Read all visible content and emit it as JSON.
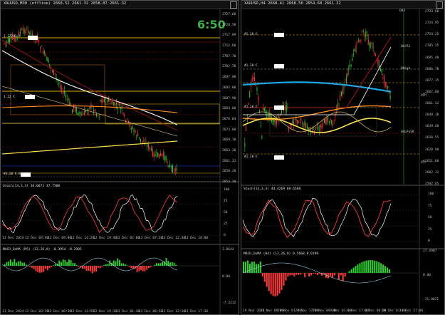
{
  "left": {
    "title": "XAUUSD,M30 (offline)",
    "ohlc": "2668.52 2661.32 2658.87 2661.32",
    "timer": "6:50",
    "price_axis": [
      "2727.60",
      "2720.50",
      "2717.89",
      "2712.60",
      "2707.70",
      "2702.70",
      "2697.80",
      "2692.80",
      "2687.90",
      "2683.00",
      "2678.04",
      "2673.00",
      "2668.10",
      "2663.30",
      "2661.32",
      "2658.20",
      "2653.30"
    ],
    "time_axis": [
      "11 Dec 2024",
      "12 Dec 03:40",
      "12 Dec 09:00",
      "12 Dec 14:20",
      "12 Dec 19:40",
      "13 Dec 02:00",
      "13 Dec 07:20",
      "13 Dec 12:40",
      "13 Dec 18:00"
    ],
    "lower_time_axis": [
      "11 Dec 2024",
      "12 Dec 03:10",
      "12 Dec 08:30",
      "12 Dec 13:50",
      "12 Dec 19:10",
      "13 Dec 01:30",
      "13 Dec 06:50",
      "13 Dec 12:10",
      "13 Dec 17:30"
    ],
    "stoch_label": "Stoch(14,3,3) 36.0071 17.7500",
    "stoch_axis": [
      "100",
      "75",
      "50",
      "25",
      "0"
    ],
    "macd_label": "MACD_OsMA (M5) (12,26,9) -0.3954 -0.2985",
    "macd_axis": [
      "3.0644",
      "0.00",
      "-7.3212"
    ],
    "level_tags": [
      "1.17291 €",
      "1.22 €",
      "1.2205 €",
      "#1.20 € Buy"
    ]
  },
  "right": {
    "title": "XAUUSD,H4",
    "ohlc": "2668.41 2668.56 2654.68 2661.32",
    "price_axis": [
      "2733.60",
      "2724.95",
      "2714.25",
      "2705.35",
      "2695.40",
      "2686.78",
      "2677.15",
      "2667.80",
      "2661.32",
      "2649.10",
      "2639.40",
      "2630.55",
      "2620.90",
      "2611.60",
      "2602.12",
      "2592.85"
    ],
    "level_labels": [
      "QH3",
      "QO/R1",
      "QHigh",
      "pQH",
      "H4LPoSR",
      "pQL"
    ],
    "time_axis": [
      "19 Nov 2024",
      "22 Nov 09:00",
      "26 Nov 01:00",
      "27 Nov 17:00",
      "29 Nov 09:00",
      "3 Dec 01:00",
      "4 Dec 17:00",
      "6 Dec 09:00",
      "10 Dec 01:00",
      "11 Dec 17:00"
    ],
    "stoch_label": "Stoch(14,3,3) 44.4269 69.6508",
    "stoch_axis": [
      "100",
      "75",
      "50",
      "25",
      "0"
    ],
    "macd_label": "MACD_OsMA (H4) (12,26,9) 0.5668 8.0199",
    "macd_axis": [
      "27.4907",
      "0.00",
      "-31.9821"
    ],
    "level_tags": [
      "#1.20 €",
      "#1.20 €",
      "#1.20 €",
      "#1.20 €",
      "#1.20 €"
    ]
  },
  "colors": {
    "bg": "#000000",
    "candle_up": "#2fd12f",
    "candle_down": "#ff3b3b",
    "ma_white": "#ffffff",
    "ma_orange": "#ff8c1a",
    "ma_yellow": "#ffe34d",
    "ma_red": "#d11a1a",
    "ma_cyan": "#1ea8e8",
    "level_gold": "#e0b000",
    "grid": "#4a4a4a",
    "timer": "#3fae49"
  }
}
